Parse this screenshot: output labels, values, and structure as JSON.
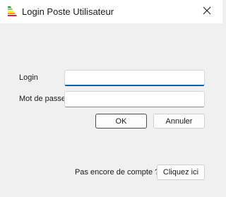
{
  "window": {
    "title": "Login Poste Utilisateur"
  },
  "form": {
    "login_label": "Login",
    "login_value": "",
    "password_label": "Mot de passe",
    "password_value": ""
  },
  "actions": {
    "ok_label": "OK",
    "cancel_label": "Annuler"
  },
  "signup": {
    "prompt": "Pas encore de compte ?",
    "link_label": "Cliquez ici"
  },
  "colors": {
    "accent": "#005fb8",
    "window_bg": "#f0f0f0",
    "titlebar_bg": "#ffffff"
  },
  "icons": {
    "app": "energy-label-icon",
    "close": "close-icon"
  }
}
